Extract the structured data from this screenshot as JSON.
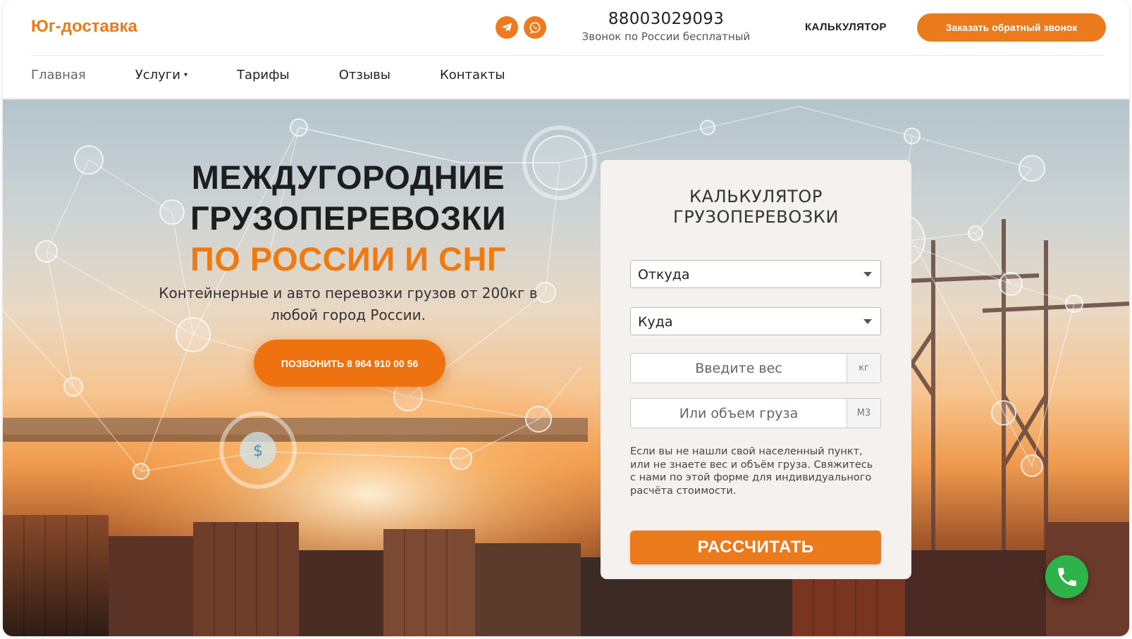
{
  "brand": {
    "logo": "Юг-доставка",
    "accent_color": "#ea7a1c"
  },
  "header": {
    "messengers": [
      {
        "name": "telegram-icon"
      },
      {
        "name": "whatsapp-icon"
      }
    ],
    "phone": "88003029093",
    "phone_note": "Звонок по России бесплатный",
    "calculator_link": "КАЛЬКУЛЯТОР",
    "callback_button": "Заказать обратный звонок"
  },
  "nav": {
    "items": [
      {
        "label": "Главная",
        "active": true
      },
      {
        "label": "Услуги",
        "dropdown": true
      },
      {
        "label": "Тарифы"
      },
      {
        "label": "Отзывы"
      },
      {
        "label": "Контакты"
      }
    ]
  },
  "hero": {
    "title_line1": "МЕЖДУГОРОДНИЕ",
    "title_line2": "ГРУЗОПЕРЕВОЗКИ",
    "title_line3": "ПО РОССИИ И СНГ",
    "subtitle": "Контейнерные и авто перевозки грузов от 200кг в любой город России.",
    "call_button": "ПОЗВОНИТЬ 8 964 910 00 56"
  },
  "calculator": {
    "title_line1": "КАЛЬКУЛЯТОР",
    "title_line2": "ГРУЗОПЕРЕВОЗКИ",
    "from_value": "Откуда",
    "to_value": "Куда",
    "weight_placeholder": "Введите вес",
    "weight_unit": "кг",
    "volume_placeholder": "Или объем груза",
    "volume_unit": "М3",
    "note": "Если вы не нашли свой населенный пункт, или не знаете вес и объём груза. Свяжитесь с нами по этой форме для индивидуального расчёта стоимости.",
    "submit": "РАССЧИТАТЬ"
  },
  "floating": {
    "icon": "phone-icon",
    "color": "#2eb24a"
  }
}
